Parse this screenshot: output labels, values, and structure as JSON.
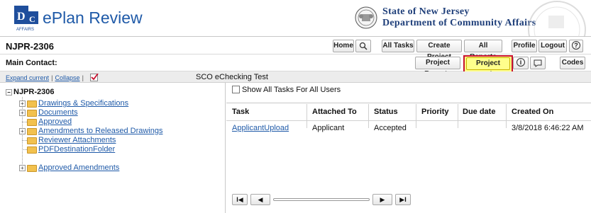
{
  "app": {
    "title": "ePlan Review",
    "state_line1": "State of New Jersey",
    "state_line2": "Department of Community Affairs"
  },
  "toolbar": {
    "project_code": "NJPR-2306",
    "home": "Home",
    "all_tasks": "All Tasks",
    "create_project": "Create Project",
    "all_reports": "All Reports",
    "profile": "Profile",
    "logout": "Logout",
    "help_icon_glyph": "?",
    "main_contact_label": "Main Contact:",
    "project_reports": "Project Reports",
    "project_tasks": "Project Tasks",
    "info_icon_glyph": "i",
    "codes": "Codes"
  },
  "subbar": {
    "expand_current": "Expand current",
    "separator": "|",
    "collapse": "Collapse",
    "separator2": "|",
    "sco_label": "SCO eChecking Test"
  },
  "tree": {
    "root": "NJPR-2306",
    "items": [
      {
        "label": "Drawings & Specifications",
        "expandable": true
      },
      {
        "label": "Documents",
        "expandable": true
      },
      {
        "label": "Approved",
        "expandable": false
      },
      {
        "label": "Amendments to Released Drawings",
        "expandable": true
      },
      {
        "label": "Reviewer Attachments",
        "expandable": false
      },
      {
        "label": "PDFDestinationFolder",
        "expandable": false
      },
      {
        "label": "Approved Amendments",
        "expandable": true
      }
    ]
  },
  "tasks": {
    "show_all_label": "Show All Tasks For All Users",
    "columns": [
      "Task",
      "Attached To",
      "Status",
      "Priority",
      "Due date",
      "Created On"
    ],
    "rows": [
      {
        "task": "ApplicantUpload",
        "attached_to": "Applicant",
        "status": "Accepted",
        "priority": "",
        "due_date": "",
        "created_on": "3/8/2018 6:46:22 AM"
      }
    ],
    "pager": {
      "first": "I◀",
      "prev": "◀",
      "next": "▶",
      "last": "▶I"
    }
  },
  "colors": {
    "brand_blue": "#1f5aa8",
    "highlight_yellow": "#ffff8c",
    "highlight_border": "#c8102e"
  }
}
